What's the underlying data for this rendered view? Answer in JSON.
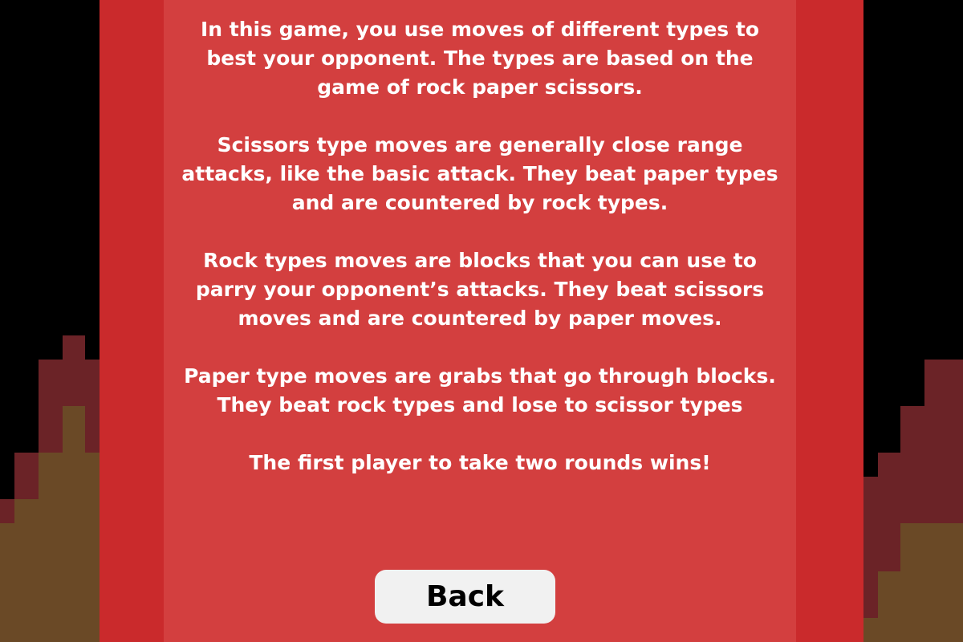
{
  "rules": {
    "paragraphs": [
      "In this game, you use moves of different types to best your opponent. The types are based on the game of rock paper scissors.",
      "Scissors type moves are generally close range attacks, like the basic attack. They beat paper types and are countered by rock types.",
      "Rock types moves are blocks that you can use to parry your opponent’s attacks. They beat scissors moves and are countered by paper moves.",
      "Paper type moves are grabs that go through blocks. They beat rock types and lose to scissor types",
      "The first player to take two rounds wins!"
    ]
  },
  "back_button": {
    "label": "Back"
  },
  "colors": {
    "background": "#000000",
    "outer_panel": "#ca2a2c",
    "inner_panel": "#d33f3f",
    "text": "#ffffff",
    "button_bg": "#f1f1f1",
    "flame_dark": "#6b2327",
    "flame_light": "#6a4926"
  }
}
